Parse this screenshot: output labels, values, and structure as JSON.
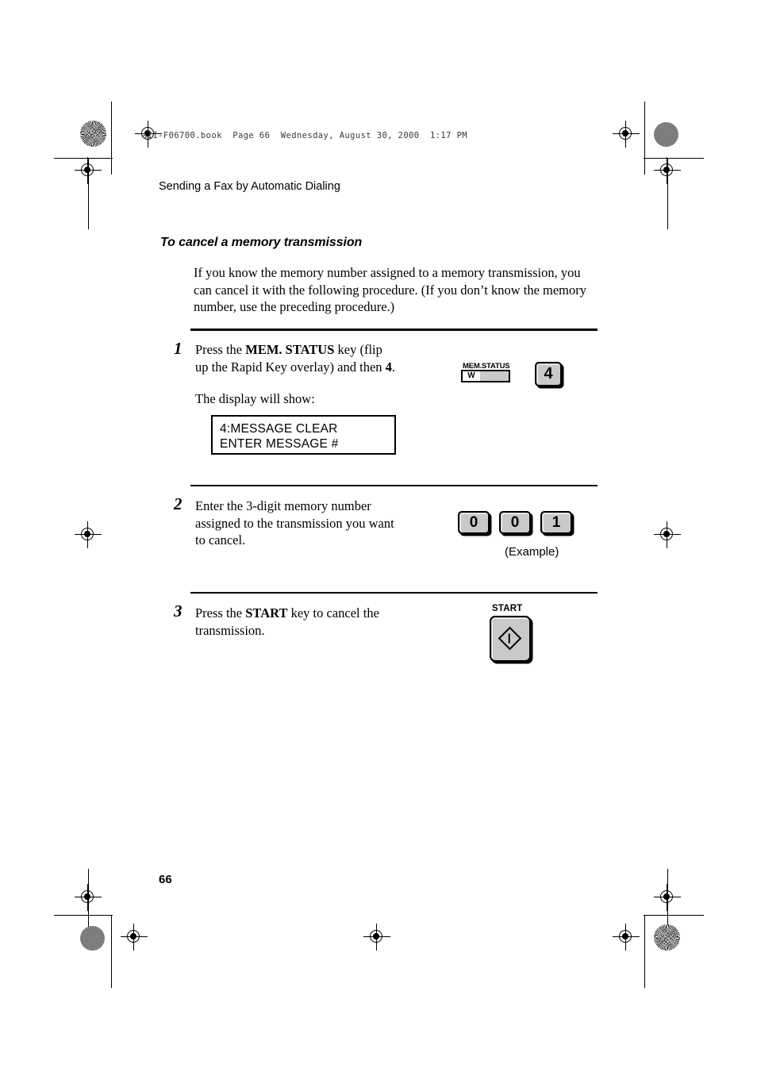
{
  "print_marks": {
    "file_header": "aII-F06700.book  Page 66  Wednesday, August 30, 2000  1:17 PM"
  },
  "running_head": "Sending a Fax by Automatic Dialing",
  "section": {
    "title": "To cancel a memory transmission",
    "intro": "If you know the memory number assigned to a memory transmission, you can cancel it with the following procedure. (If you don’t know the memory number, use the preceding procedure.)"
  },
  "steps": [
    {
      "number": "1",
      "text_line1_a": "Press the ",
      "text_line1_b": "MEM. STATUS",
      "text_line1_c": " key (flip",
      "text_line2_a": "up the Rapid Key overlay) and then ",
      "text_line2_b": "4",
      "text_line2_c": ".",
      "display_intro": "The display will show:",
      "lcd_line1": "4:MESSAGE CLEAR",
      "lcd_line2": "ENTER MESSAGE #",
      "mem_status_label": "MEM.STATUS",
      "mem_status_value": "W",
      "key_label": "4"
    },
    {
      "number": "2",
      "text_line1": "Enter the 3-digit memory number",
      "text_line2": "assigned to the transmission you want",
      "text_line3": "to cancel.",
      "keys": [
        "0",
        "0",
        "1"
      ],
      "example_caption": "(Example)"
    },
    {
      "number": "3",
      "text_line1_a": "Press the ",
      "text_line1_b": "START",
      "text_line1_c": " key to cancel the",
      "text_line2": "transmission.",
      "key_caption": "START"
    }
  ],
  "page_number": "66",
  "colors": {
    "key_face": "#c9c9c9",
    "ink": "#000000",
    "paper": "#ffffff"
  }
}
